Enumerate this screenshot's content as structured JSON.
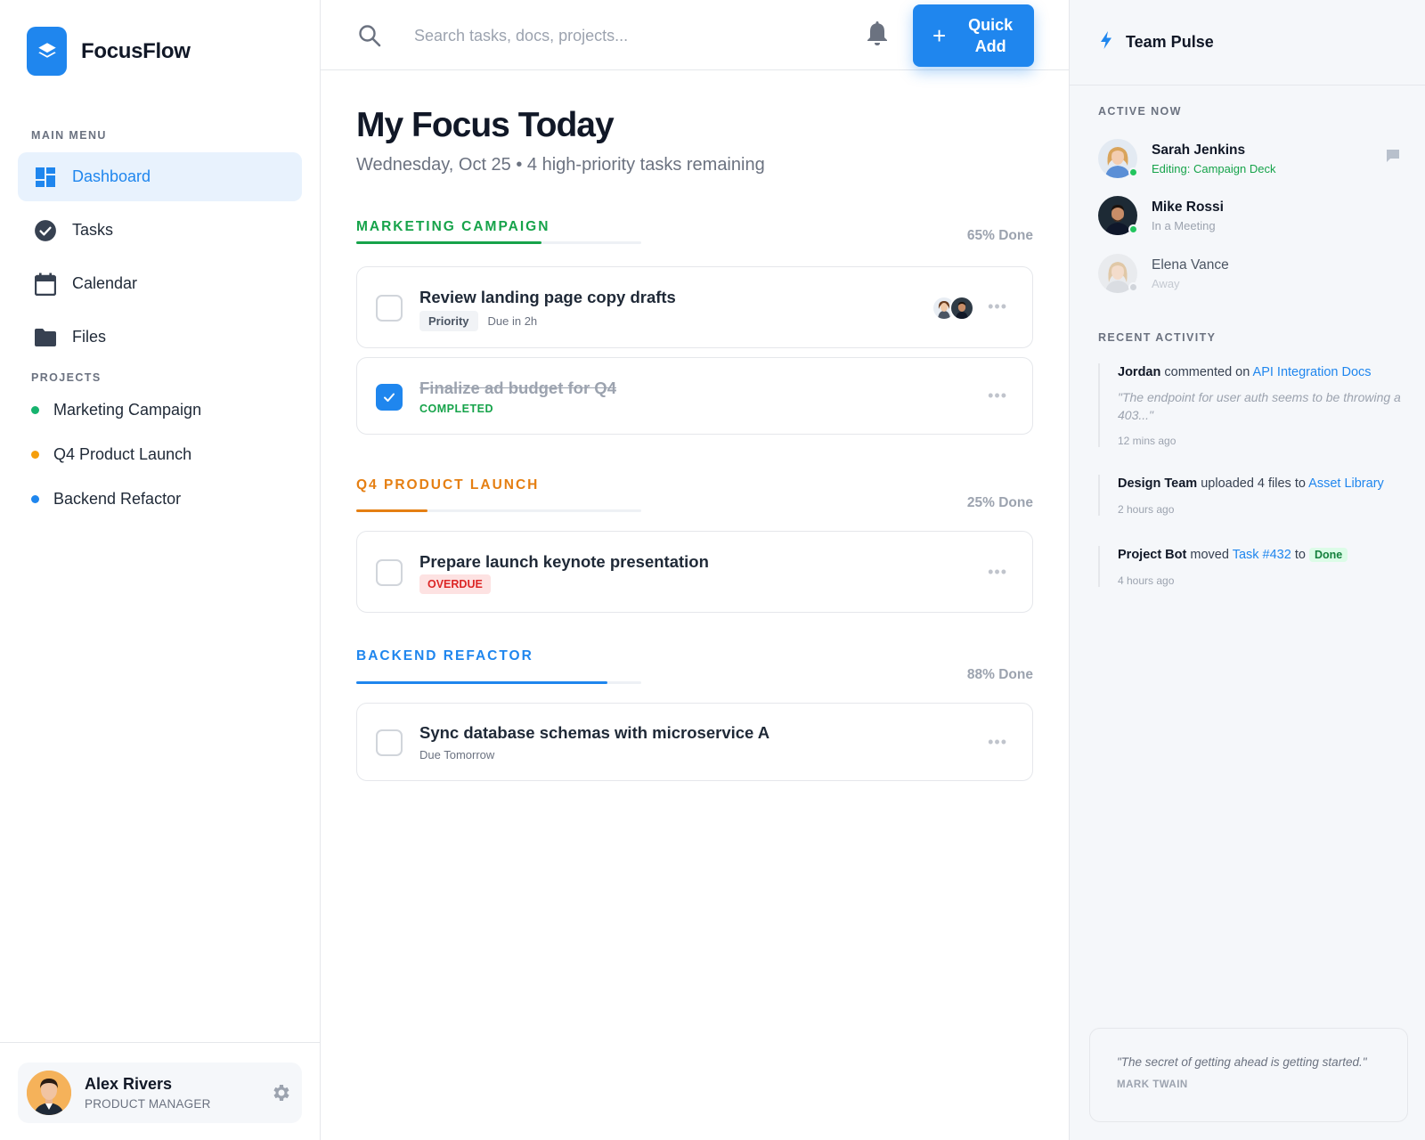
{
  "brand": {
    "name": "FocusFlow",
    "accent": "#1f86ee",
    "logo_icon": "layers-icon"
  },
  "sidebar": {
    "main_menu_label": "MAIN MENU",
    "items": [
      {
        "label": "Dashboard",
        "icon": "dashboard-icon",
        "active": true
      },
      {
        "label": "Tasks",
        "icon": "check-circle-icon",
        "active": false
      },
      {
        "label": "Calendar",
        "icon": "calendar-icon",
        "active": false
      },
      {
        "label": "Files",
        "icon": "folder-icon",
        "active": false
      }
    ],
    "projects_label": "PROJECTS",
    "projects": [
      {
        "label": "Marketing Campaign",
        "color": "#16b36e"
      },
      {
        "label": "Q4 Product Launch",
        "color": "#f59e0b"
      },
      {
        "label": "Backend Refactor",
        "color": "#1f86ee"
      }
    ],
    "user": {
      "name": "Alex Rivers",
      "role": "PRODUCT MANAGER",
      "settings_icon": "gear-icon"
    }
  },
  "topbar": {
    "search_placeholder": "Search tasks, docs, projects...",
    "notification_icon": "bell-icon",
    "quick_add_label": "Quick Add"
  },
  "main": {
    "title": "My Focus Today",
    "subtitle": "Wednesday, Oct 25 • 4 high-priority tasks remaining",
    "groups": [
      {
        "title": "MARKETING CAMPAIGN",
        "color": "#16a34a",
        "progress": 0.65,
        "done_label": "65% Done",
        "tasks": [
          {
            "title": "Review landing page copy drafts",
            "tag": "Priority",
            "due": "Due in 2h",
            "completed": false
          },
          {
            "title": "Finalize ad budget for Q4",
            "status": "COMPLETED",
            "completed": true
          }
        ]
      },
      {
        "title": "Q4 PRODUCT LAUNCH",
        "color": "#e57f12",
        "progress": 0.25,
        "done_label": "25% Done",
        "tasks": [
          {
            "title": "Prepare launch keynote presentation",
            "status": "OVERDUE",
            "completed": false
          }
        ]
      },
      {
        "title": "BACKEND REFACTOR",
        "color": "#1f86ee",
        "progress": 0.88,
        "done_label": "88% Done",
        "tasks": [
          {
            "title": "Sync database schemas with microservice A",
            "due": "Due Tomorrow",
            "completed": false
          }
        ]
      }
    ]
  },
  "team_pulse": {
    "title": "Team Pulse",
    "active_label": "ACTIVE NOW",
    "members": [
      {
        "name": "Sarah Jenkins",
        "status": "Editing: Campaign Deck",
        "presence": "online"
      },
      {
        "name": "Mike Rossi",
        "status": "In a Meeting",
        "presence": "online"
      },
      {
        "name": "Elena Vance",
        "status": "Away",
        "presence": "away"
      }
    ],
    "activity_label": "RECENT ACTIVITY",
    "activities": [
      {
        "actor": "Jordan",
        "verb": "commented on",
        "target": "API Integration Docs",
        "quote": "\"The endpoint for user auth seems to be throwing a 403...\"",
        "time": "12 mins ago"
      },
      {
        "actor": "Design Team",
        "verb": "uploaded 4 files to",
        "target": "Asset Library",
        "time": "2 hours ago"
      },
      {
        "actor": "Project Bot",
        "verb": "moved",
        "target": "Task #432",
        "connector": "to",
        "badge": "Done",
        "time": "4 hours ago"
      }
    ],
    "quote": {
      "text": "\"The secret of getting ahead is getting started.\"",
      "author": "MARK TWAIN"
    }
  }
}
